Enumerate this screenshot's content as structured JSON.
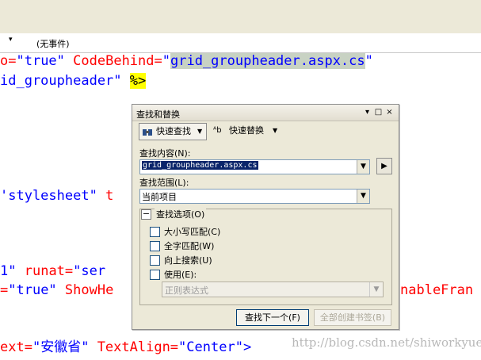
{
  "nav": {
    "arrow": "▾",
    "events": "(无事件)"
  },
  "code": {
    "line1_attr_tail": "o=",
    "line1_val1": "\"true\"",
    "line1_attr2": "CodeBehind=",
    "line1_q1": "\"",
    "line1_val2": "grid_groupheader.aspx.cs",
    "line1_q2": "\"",
    "line2_val": "id_groupheader\"",
    "line2_tag": "%>",
    "line3_val": "'stylesheet\"",
    "line3_attr": "t",
    "line4_attr": "1\"",
    "line4_a2": "runat=",
    "line4_v2": "\"ser",
    "line5_attr": "=",
    "line5_val": "\"true\"",
    "line5_a2": "ShowHe",
    "line5_tail": "nableFran",
    "line6_attr": "ext=",
    "line6_val": "\"安徽省\"",
    "line6_a2": "TextAlign=",
    "line6_v2": "\"Center\"",
    "line6_tag": ">"
  },
  "watermark": "http://blog.csdn.net/shiworkyue",
  "dialog": {
    "title": "查找和替换",
    "title_buttons": [
      "▾",
      "□",
      "×"
    ],
    "quick_find": "快速查找",
    "quick_replace": "快速替换",
    "find_what_label": "查找内容(N):",
    "find_what_value": "grid_groupheader.aspx.cs",
    "look_in_label": "查找范围(L):",
    "look_in_value": "当前项目",
    "find_options_label": "查找选项(O)",
    "options": [
      {
        "label": "大小写匹配(C)",
        "checked": false
      },
      {
        "label": "全字匹配(W)",
        "checked": false
      },
      {
        "label": "向上搜索(U)",
        "checked": false
      },
      {
        "label": "使用(E):",
        "checked": false
      }
    ],
    "use_type_value": "正则表达式",
    "find_next": "查找下一个(F)",
    "bookmark_all": "全部创建书签(B)"
  }
}
